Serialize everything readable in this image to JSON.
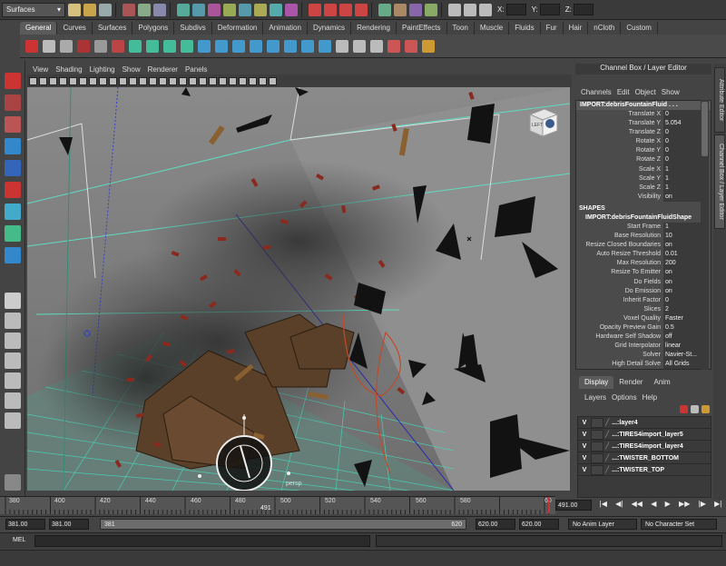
{
  "status_line": {
    "menu_set": "Surfaces",
    "coords": [
      {
        "label": "X:"
      },
      {
        "label": "Y:"
      },
      {
        "label": "Z:"
      }
    ]
  },
  "shelf": {
    "tabs": [
      "General",
      "Curves",
      "Surfaces",
      "Polygons",
      "Subdivs",
      "Deformation",
      "Animation",
      "Dynamics",
      "Rendering",
      "PaintEffects",
      "Toon",
      "Muscle",
      "Fluids",
      "Fur",
      "Hair",
      "nCloth",
      "Custom"
    ],
    "active_tab": "General"
  },
  "viewport": {
    "menus": [
      "View",
      "Shading",
      "Lighting",
      "Show",
      "Renderer",
      "Panels"
    ],
    "camera_label": "persp",
    "viewcube_label": "LEFT"
  },
  "channel_box": {
    "title": "Channel Box / Layer Editor",
    "menus": [
      "Channels",
      "Edit",
      "Object",
      "Show"
    ],
    "object_name": "IMPORT:debrisFountainFluid . . .",
    "transform_channels": [
      {
        "name": "Translate X",
        "value": "0"
      },
      {
        "name": "Translate Y",
        "value": "5.054"
      },
      {
        "name": "Translate Z",
        "value": "0"
      },
      {
        "name": "Rotate X",
        "value": "0"
      },
      {
        "name": "Rotate Y",
        "value": "0"
      },
      {
        "name": "Rotate Z",
        "value": "0"
      },
      {
        "name": "Scale X",
        "value": "1"
      },
      {
        "name": "Scale Y",
        "value": "1"
      },
      {
        "name": "Scale Z",
        "value": "1"
      },
      {
        "name": "Visibility",
        "value": "on"
      }
    ],
    "shapes_header": "SHAPES",
    "shape_name": "IMPORT:debrisFountainFluidShape",
    "shape_channels": [
      {
        "name": "Start Frame",
        "value": "1"
      },
      {
        "name": "Base Resolution",
        "value": "10"
      },
      {
        "name": "Resize Closed Boundaries",
        "value": "on"
      },
      {
        "name": "Auto Resize Threshold",
        "value": "0.01"
      },
      {
        "name": "Max Resolution",
        "value": "200"
      },
      {
        "name": "Resize To Emitter",
        "value": "on"
      },
      {
        "name": "Do Fields",
        "value": "on"
      },
      {
        "name": "Do Emission",
        "value": "on"
      },
      {
        "name": "Inherit Factor",
        "value": "0"
      },
      {
        "name": "Slices",
        "value": "2"
      },
      {
        "name": "Voxel Quality",
        "value": "Faster"
      },
      {
        "name": "Opacity Preview Gain",
        "value": "0.5"
      },
      {
        "name": "Hardware Self Shadow",
        "value": "off"
      },
      {
        "name": "Grid Interpolator",
        "value": "linear"
      },
      {
        "name": "Solver",
        "value": "Navier-St..."
      },
      {
        "name": "High Detail Solve",
        "value": "All Grids"
      }
    ]
  },
  "side_tabs": [
    "Attribute Editor",
    "Channel Box / Layer Editor"
  ],
  "layer_editor": {
    "tabs": [
      "Display",
      "Render",
      "Anim"
    ],
    "active_tab": "Display",
    "menus": [
      "Layers",
      "Options",
      "Help"
    ],
    "layers": [
      {
        "visible": "V",
        "name": "...:layer4"
      },
      {
        "visible": "V",
        "name": "...:TIRES4import_layer5"
      },
      {
        "visible": "V",
        "name": "...:TIRES4import_layer4"
      },
      {
        "visible": "V",
        "name": "...:TWISTER_BOTTOM"
      },
      {
        "visible": "V",
        "name": "...:TWISTER_TOP"
      }
    ]
  },
  "time_slider": {
    "ticks": [
      "380",
      "400",
      "420",
      "440",
      "460",
      "480",
      "500",
      "520",
      "540",
      "560",
      "580",
      "60"
    ],
    "current_frame_label": "491",
    "current_frame_field": "491.00",
    "playback_glyphs": [
      "|◀",
      "◀|",
      "◀◀",
      "◀",
      "▶",
      "▶▶",
      "|▶",
      "▶|"
    ]
  },
  "range_slider": {
    "start_time": "381.00",
    "playback_start": "381.00",
    "range_start_label": "381",
    "range_end_label": "620",
    "playback_end": "620.00",
    "end_time": "620.00",
    "anim_layer": "No Anim Layer",
    "character_set": "No Character Set"
  },
  "command_line": {
    "label": "MEL"
  },
  "colors": {
    "bg": "#444444",
    "viewport_bg": "#777777",
    "grid": "#47d6b8",
    "accent_red": "#cc3333"
  }
}
